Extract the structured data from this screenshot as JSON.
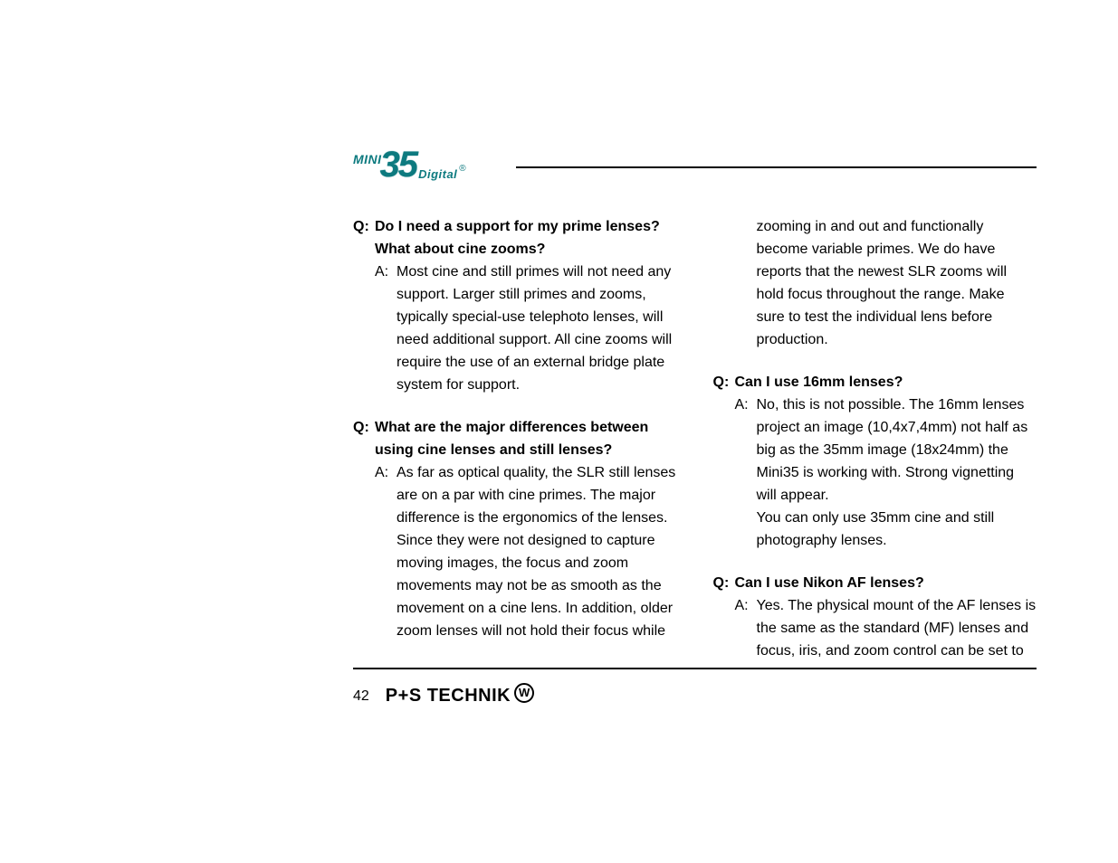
{
  "logo": {
    "mini": "MINI",
    "num": "35",
    "digital": "Digital",
    "reg": "®"
  },
  "col1": {
    "qa1": {
      "qLabel": "Q:",
      "qText": "Do I need a support for my prime lenses? What about cine zooms?",
      "aLabel": "A:",
      "aText": "Most cine and still primes will not need any support. Larger still primes and zooms, typically special-use telephoto lenses, will need additional support. All cine zooms will require the use of an external bridge plate system for support."
    },
    "qa2": {
      "qLabel": "Q:",
      "qText": "What are the major differences between using cine lenses and still lenses?",
      "aLabel": "A:",
      "aText": "As far as optical quality, the SLR still lenses are on a par with cine primes. The major difference is the ergonomics of the lenses. Since they were not designed to capture moving images, the focus and zoom movements may not be as smooth as the movement on a cine lens. In addition, older zoom lenses will not hold their focus while"
    }
  },
  "col2": {
    "cont": "zooming in and out and functionally become variable primes. We do have reports that the newest SLR zooms will hold focus throughout the range. Make sure to test the individual lens before production.",
    "qa3": {
      "qLabel": "Q:",
      "qText": "Can I use 16mm lenses?",
      "aLabel": "A:",
      "aText": "No, this is not possible. The 16mm lenses project an image (10,4x7,4mm) not half as big as the 35mm image (18x24mm) the Mini35 is working with. Strong vignetting will appear.",
      "aText2": "You can only use 35mm cine and still photography lenses."
    },
    "qa4": {
      "qLabel": "Q:",
      "qText": "Can I use Nikon AF lenses?",
      "aLabel": "A:",
      "aText": "Yes. The physical mount of the AF lenses is the same as the standard (MF) lenses and focus, iris, and zoom control can be set to"
    }
  },
  "footer": {
    "page": "42",
    "brand": "P+S TECHNIK",
    "wmark": "W"
  }
}
